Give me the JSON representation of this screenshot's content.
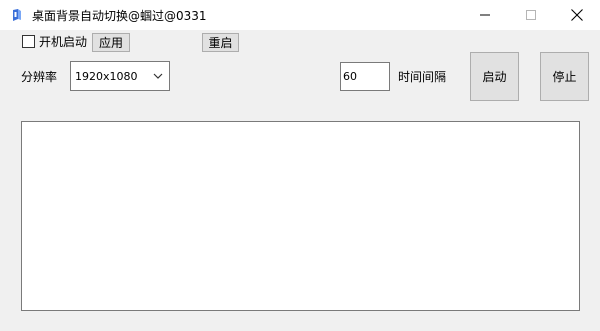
{
  "window": {
    "title": "桌面背景自动切换@蝈过@0331"
  },
  "controls": {
    "autostart_label": "开机启动",
    "autostart_checked": false,
    "apply_label": "应用",
    "restart_label": "重启",
    "resolution_label": "分辨率",
    "resolution_value": "1920x1080",
    "interval_value": "60",
    "interval_label": "时间间隔",
    "start_label": "启动",
    "stop_label": "停止"
  },
  "log": {
    "content": ""
  }
}
